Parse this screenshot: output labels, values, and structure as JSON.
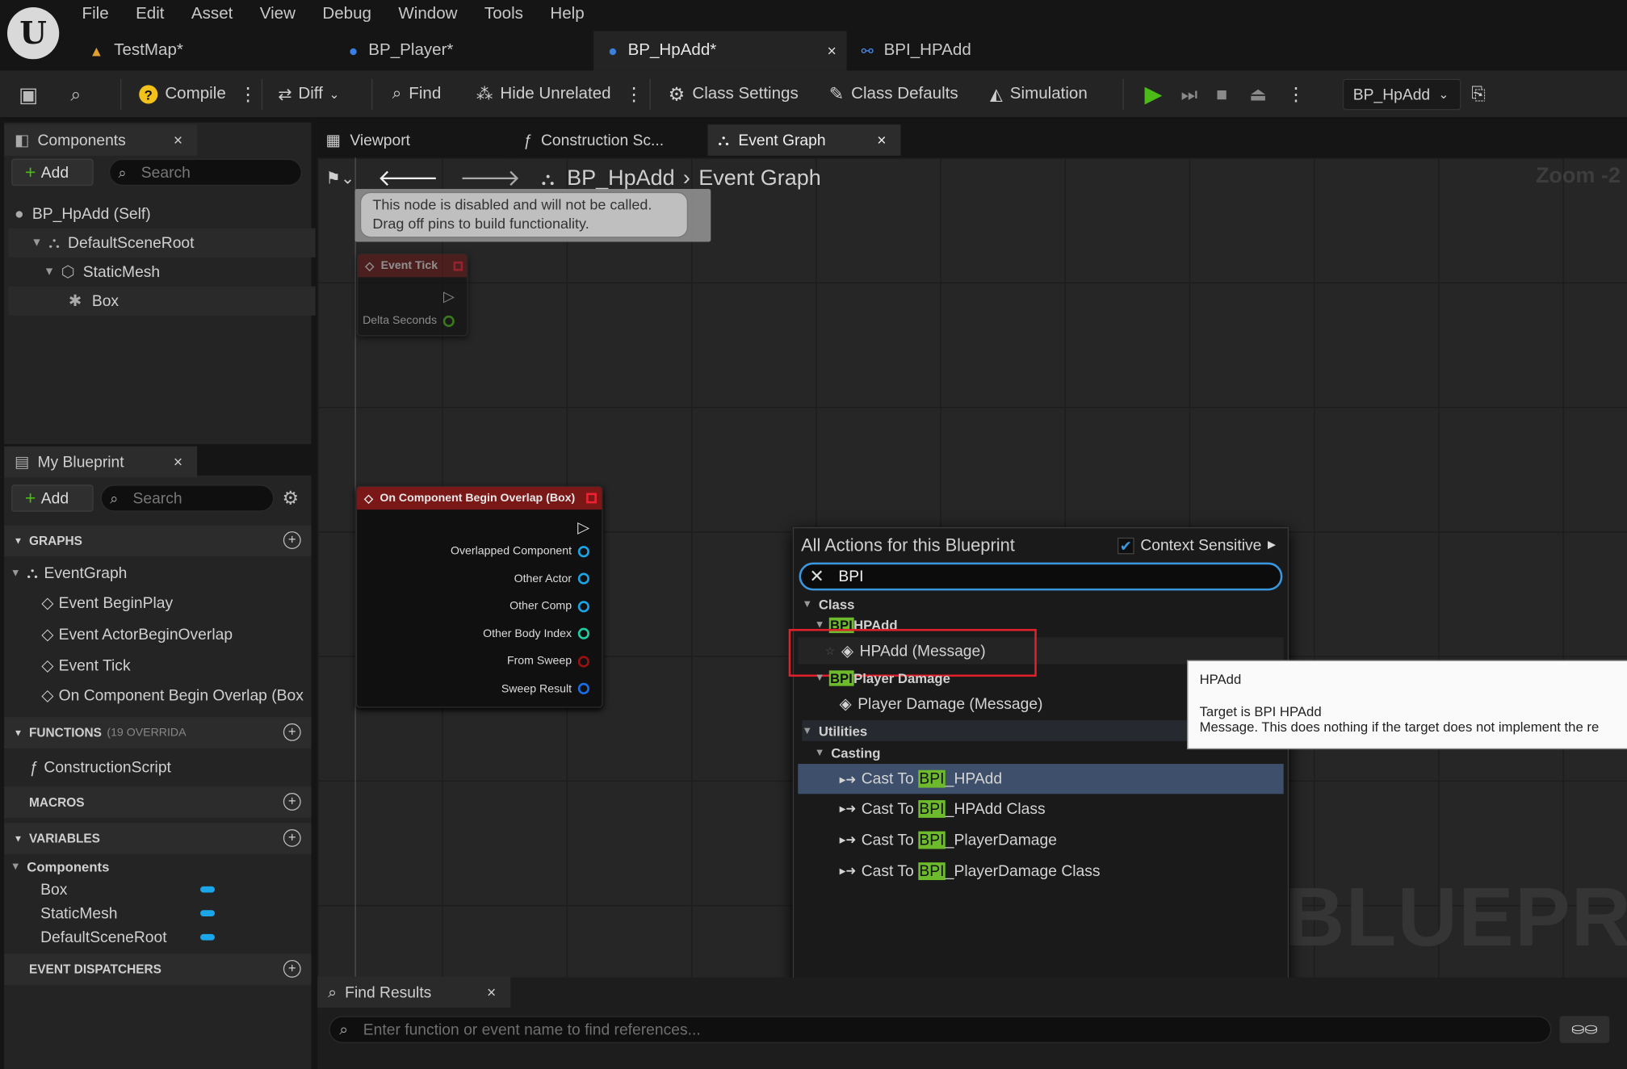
{
  "menu": [
    "File",
    "Edit",
    "Asset",
    "View",
    "Debug",
    "Window",
    "Tools",
    "Help"
  ],
  "doc_tabs": [
    {
      "label": "TestMap*",
      "icon": "level-icon"
    },
    {
      "label": "BP_Player*",
      "icon": "blueprint-actor-icon"
    },
    {
      "label": "BP_HpAdd*",
      "icon": "blueprint-actor-icon",
      "close": "×"
    },
    {
      "label": "BPI_HPAdd",
      "icon": "blueprint-interface-icon"
    }
  ],
  "toolbar": {
    "compile": "Compile",
    "diff": "Diff",
    "find": "Find",
    "hide_unrelated": "Hide Unrelated",
    "class_settings": "Class Settings",
    "class_defaults": "Class Defaults",
    "simulation": "Simulation",
    "debug_object": "BP_HpAdd"
  },
  "components_panel": {
    "title": "Components",
    "close": "×",
    "add": "Add",
    "search_placeholder": "Search",
    "items": [
      {
        "label": "BP_HpAdd (Self)",
        "icon": "self-icon"
      },
      {
        "label": "DefaultSceneRoot",
        "icon": "scene-root-icon"
      },
      {
        "label": "StaticMesh",
        "icon": "static-mesh-icon"
      },
      {
        "label": "Box",
        "icon": "box-collision-icon"
      }
    ]
  },
  "editor_tabs": [
    {
      "label": "Viewport"
    },
    {
      "label": "Construction Sc..."
    },
    {
      "label": "Event Graph",
      "close": "×"
    }
  ],
  "my_blueprint": {
    "title": "My Blueprint",
    "close": "×",
    "add": "Add",
    "search_placeholder": "Search",
    "graphs_header": "GRAPHS",
    "event_graph": "EventGraph",
    "events": [
      "Event BeginPlay",
      "Event ActorBeginOverlap",
      "Event Tick",
      "On Component Begin Overlap (Box"
    ],
    "functions_header": "FUNCTIONS",
    "functions_suffix": "(19 OVERRIDA",
    "functions": [
      "ConstructionScript"
    ],
    "macros_header": "MACROS",
    "variables_header": "VARIABLES",
    "variables_group": "Components",
    "variables": [
      "Box",
      "StaticMesh",
      "DefaultSceneRoot"
    ],
    "dispatchers_header": "EVENT DISPATCHERS"
  },
  "graph": {
    "breadcrumb_root": "BP_HpAdd",
    "breadcrumb_leaf": "Event Graph",
    "zoom": "Zoom -2",
    "watermark": "BLUEPRINT",
    "disabled_comment_line1": "This node is disabled and will not be called.",
    "disabled_comment_line2": "Drag off pins to build functionality.",
    "event_tick": {
      "title": "Event Tick",
      "pins": [
        "Delta Seconds"
      ]
    },
    "overlap_node": {
      "title": "On Component Begin Overlap (Box)",
      "pins": [
        {
          "label": "Overlapped Component",
          "color": "#1aa6e8"
        },
        {
          "label": "Other Actor",
          "color": "#1aa6e8"
        },
        {
          "label": "Other Comp",
          "color": "#1aa6e8"
        },
        {
          "label": "Other Body Index",
          "color": "#1fcfa0"
        },
        {
          "label": "From Sweep",
          "color": "#9b1010"
        },
        {
          "label": "Sweep Result",
          "color": "#1a6ee8"
        }
      ]
    }
  },
  "action_menu": {
    "title": "All Actions for this Blueprint",
    "context_sensitive": "Context Sensitive",
    "search_value": "BPI",
    "class_cat": "Class",
    "bpi_hl": "BPI",
    "hpadd_sub": "HPAdd",
    "hpadd_action": "HPAdd (Message)",
    "playerdamage_sub": "Player Damage",
    "playerdamage_action": "Player Damage (Message)",
    "utilities_cat": "Utilities",
    "casting_cat": "Casting",
    "cast_prefix": "Cast To ",
    "casts": [
      {
        "rest": "_HPAdd"
      },
      {
        "rest": "_HPAdd Class"
      },
      {
        "rest": "_PlayerDamage"
      },
      {
        "rest": "_PlayerDamage Class"
      }
    ]
  },
  "tooltip": {
    "title": "HPAdd",
    "line1": "Target is BPI HPAdd",
    "line2": "Message. This does nothing if the target does not implement the re"
  },
  "find_results": {
    "title": "Find Results",
    "close": "×",
    "placeholder": "Enter function or event name to find references..."
  },
  "colors": {
    "accent_blue": "#3a96dd",
    "play_green": "#4cbb17",
    "highlight_red": "#e0202a",
    "search_highlight": "#6dbb2c",
    "event_red": "#7a1818"
  }
}
